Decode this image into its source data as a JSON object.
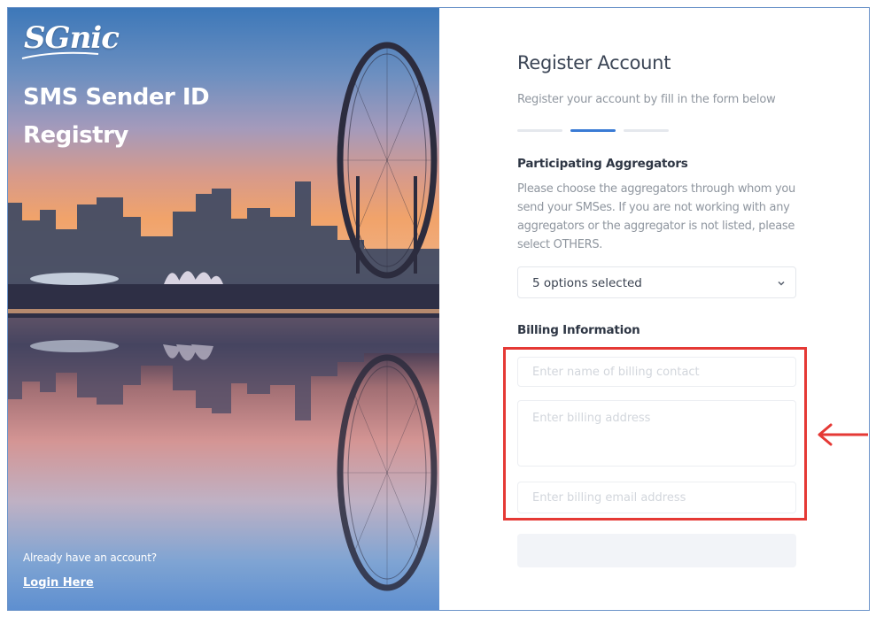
{
  "hero": {
    "logo_text": "SGnic",
    "title_line1": "SMS Sender ID",
    "title_line2": "Registry",
    "have_account_text": "Already have an account?",
    "login_link": "Login Here"
  },
  "form": {
    "title": "Register Account",
    "subtitle": "Register your account by fill in the form below",
    "steps": {
      "total": 3,
      "current": 2
    },
    "aggregators": {
      "label": "Participating Aggregators",
      "help": "Please choose the aggregators through whom you send your SMSes. If you are not working with any aggregators or the aggregator is not listed, please select OTHERS.",
      "selected_value": "5 options selected"
    },
    "billing": {
      "label": "Billing Information",
      "contact_placeholder": "Enter name of billing contact",
      "address_placeholder": "Enter billing address",
      "email_placeholder": "Enter billing email address"
    },
    "submit_label": ""
  },
  "annotation": {
    "highlight_color": "#e53935",
    "arrow_icon": "arrow-left-icon"
  },
  "colors": {
    "accent": "#3a7bd5",
    "title": "#3c4656",
    "muted": "#8f969f"
  }
}
